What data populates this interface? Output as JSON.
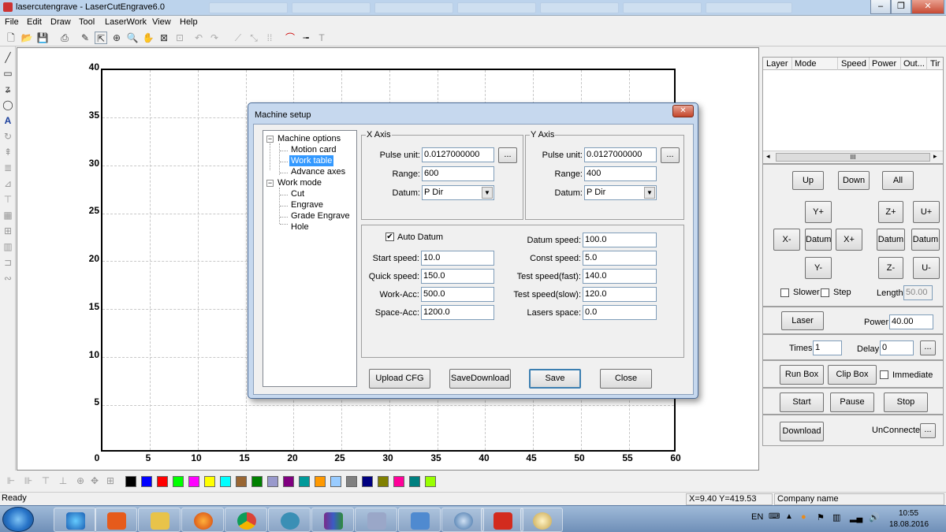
{
  "window": {
    "title": "lasercutengrave - LaserCutEngrave6.0",
    "minimize": "–",
    "maximize": "❐",
    "close": "✕"
  },
  "menu": [
    "File",
    "Edit",
    "Draw",
    "Tool",
    "LaserWork",
    "View",
    "Help"
  ],
  "canvas": {
    "y_ticks": [
      "40",
      "35",
      "30",
      "25",
      "20",
      "15",
      "10",
      "5"
    ],
    "x_ticks": [
      "0",
      "5",
      "10",
      "15",
      "20",
      "25",
      "30",
      "35",
      "40",
      "45",
      "50",
      "55",
      "60"
    ]
  },
  "layer_table": {
    "columns": [
      "Layer",
      "Mode",
      "Speed",
      "Power",
      "Out...",
      "Tir"
    ],
    "scroll_mark": "III"
  },
  "controls": {
    "up": "Up",
    "down": "Down",
    "all": "All",
    "y_plus": "Y+",
    "z_plus": "Z+",
    "u_plus": "U+",
    "x_minus": "X-",
    "datum": "Datum",
    "x_plus": "X+",
    "y_minus": "Y-",
    "z_minus": "Z-",
    "u_minus": "U-",
    "slower": "Slower",
    "step": "Step",
    "length_label": "Length:",
    "length_value": "50.00",
    "laser": "Laser",
    "power_label": "Power:",
    "power_value": "40.00",
    "times_label": "Times:",
    "times_value": "1",
    "delay_label": "Delay:",
    "delay_value": "0",
    "ellipsis": "...",
    "run_box": "Run Box",
    "clip_box": "Clip Box",
    "immediate": "Immediate",
    "start": "Start",
    "pause": "Pause",
    "stop": "Stop",
    "download": "Download",
    "connection": "UnConnected"
  },
  "dialog": {
    "title": "Machine setup",
    "tree": {
      "machine_options": "Machine options",
      "motion_card": "Motion card",
      "work_table": "Work table",
      "advance_axes": "Advance axes",
      "work_mode": "Work mode",
      "cut": "Cut",
      "engrave": "Engrave",
      "grade_engrave": "Grade Engrave",
      "hole": "Hole"
    },
    "x_axis": {
      "title": "X Axis",
      "pulse_label": "Pulse unit:",
      "pulse": "0.0127000000",
      "range_label": "Range:",
      "range": "600",
      "datum_label": "Datum:",
      "datum": "P Dir"
    },
    "y_axis": {
      "title": "Y Axis",
      "pulse_label": "Pulse unit:",
      "pulse": "0.0127000000",
      "range_label": "Range:",
      "range": "400",
      "datum_label": "Datum:",
      "datum": "P Dir"
    },
    "auto_datum": "Auto Datum",
    "left": [
      {
        "label": "Start speed:",
        "value": "10.0"
      },
      {
        "label": "Quick speed:",
        "value": "150.0"
      },
      {
        "label": "Work-Acc:",
        "value": "500.0"
      },
      {
        "label": "Space-Acc:",
        "value": "1200.0"
      }
    ],
    "right": [
      {
        "label": "Datum speed:",
        "value": "100.0"
      },
      {
        "label": "Const speed:",
        "value": "5.0"
      },
      {
        "label": "Test speed(fast):",
        "value": "140.0"
      },
      {
        "label": "Test speed(slow):",
        "value": "120.0"
      },
      {
        "label": "Lasers space:",
        "value": "0.0"
      }
    ],
    "buttons": {
      "upload": "Upload CFG",
      "savedownload": "SaveDownload",
      "save": "Save",
      "close": "Close"
    }
  },
  "palette": [
    "#000000",
    "#0000ff",
    "#ff0000",
    "#00ff00",
    "#ff00ff",
    "#ffff00",
    "#00ffff",
    "#996633",
    "#008000",
    "#9999cc",
    "#800080",
    "#009999",
    "#ff9900",
    "#99ccff",
    "#808080",
    "#000080",
    "#808000",
    "#ff0099",
    "#008080",
    "#99ff00"
  ],
  "status": {
    "ready": "Ready",
    "coords": "X=9.40 Y=419.53",
    "company": "Company name"
  },
  "taskbar": {
    "lang": "EN",
    "time": "10:55",
    "date": "18.08.2016"
  }
}
